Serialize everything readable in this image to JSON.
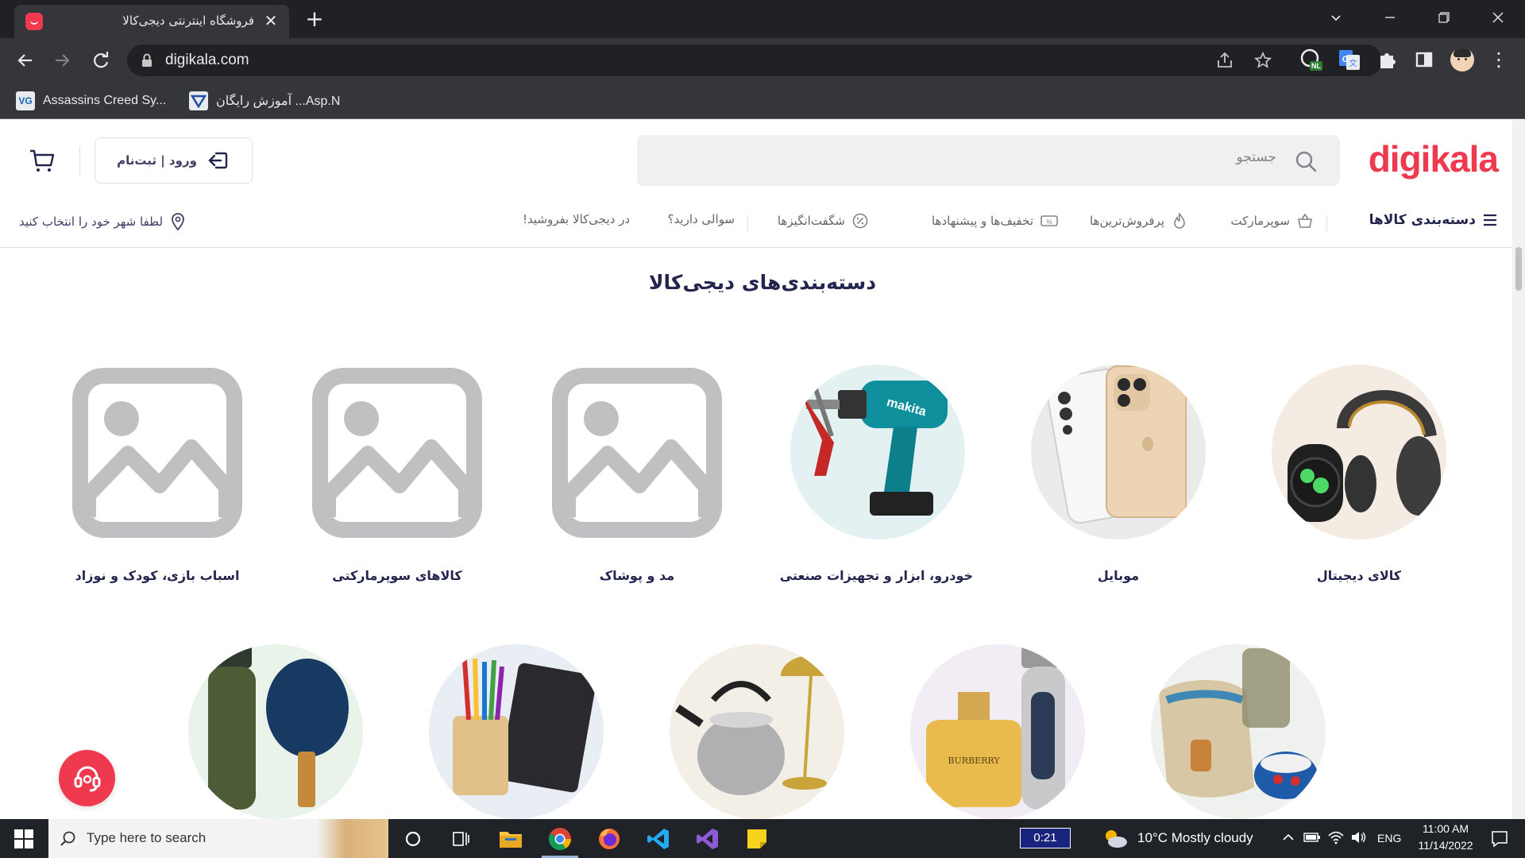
{
  "browser": {
    "tab_title": "فروشگاه اینترنتی دیجی‌کالا",
    "url": "digikala.com",
    "bookmarks": [
      {
        "label": "Assassins Creed Sy..."
      },
      {
        "label": "آموزش رایگان ...Asp.N"
      }
    ]
  },
  "header": {
    "logo": "digikala",
    "search_placeholder": "جستجو",
    "login_label": "ورود | ثبت‌نام"
  },
  "nav": {
    "categories": "دسته‌بندی کالاها",
    "supermarket": "سوپرمارکت",
    "bestsellers": "پرفروش‌ترین‌ها",
    "discounts": "تخفیف‌ها و پیشنهادها",
    "amazing": "شگفت‌انگیزها",
    "faq": "سوالی دارید؟",
    "sell": "در دیجی‌کالا بفروشید!",
    "location": "لطفا شهر خود را انتخاب کنید"
  },
  "section": {
    "title": "دسته‌بندی‌های دیجی‌کالا"
  },
  "categories": [
    {
      "label": "کالای دیجیتال"
    },
    {
      "label": "موبایل"
    },
    {
      "label": "خودرو، ابزار و تجهیزات صنعتی"
    },
    {
      "label": "مد و پوشاک"
    },
    {
      "label": "کالاهای سوپرمارکتی"
    },
    {
      "label": "اسباب بازی، کودک و نوزاد"
    }
  ],
  "taskbar": {
    "search_placeholder": "Type here to search",
    "timer": "0:21",
    "weather": "10°C  Mostly cloudy",
    "lang": "ENG",
    "time": "11:00 AM",
    "date": "11/14/2022"
  },
  "colors": {
    "brand": "#ef394e",
    "text_dark": "#23254e",
    "chrome_dark": "#202124",
    "chrome_mid": "#35363a"
  }
}
